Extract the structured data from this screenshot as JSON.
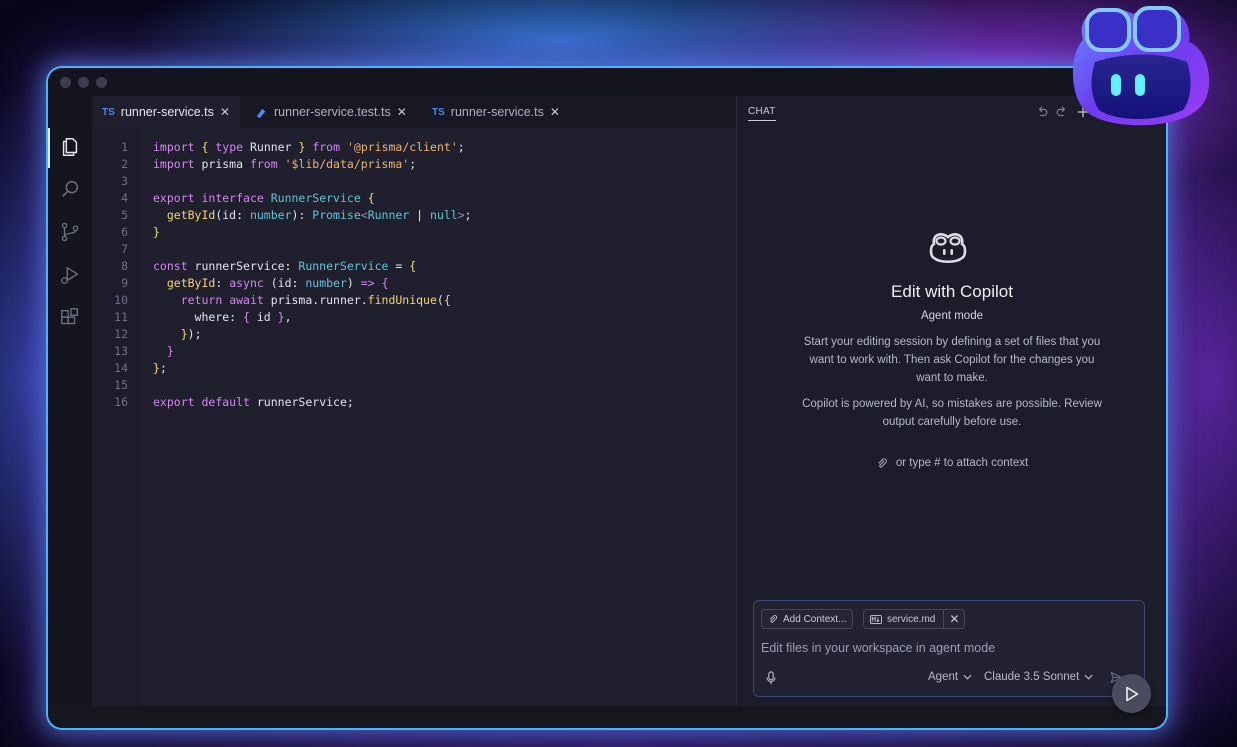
{
  "tabs": [
    {
      "badge": "TS",
      "label": "runner-service.ts",
      "close": "✕",
      "active": true
    },
    {
      "badge": "",
      "label": "runner-service.test.ts",
      "close": "✕",
      "active": false
    },
    {
      "badge": "TS",
      "label": "runner-service.ts",
      "close": "✕",
      "active": false
    }
  ],
  "code_lines": [
    [
      {
        "t": "import",
        "c": "kw"
      },
      {
        "t": " "
      },
      {
        "t": "{",
        "c": "br"
      },
      {
        "t": " "
      },
      {
        "t": "type",
        "c": "kw"
      },
      {
        "t": " Runner "
      },
      {
        "t": "}",
        "c": "br"
      },
      {
        "t": " "
      },
      {
        "t": "from",
        "c": "kw"
      },
      {
        "t": " "
      },
      {
        "t": "'@prisma/client'",
        "c": "st"
      },
      {
        "t": ";"
      }
    ],
    [
      {
        "t": "import",
        "c": "kw"
      },
      {
        "t": " prisma "
      },
      {
        "t": "from",
        "c": "kw"
      },
      {
        "t": " "
      },
      {
        "t": "'$lib/data/prisma'",
        "c": "st"
      },
      {
        "t": ";"
      }
    ],
    [],
    [
      {
        "t": "export",
        "c": "kw"
      },
      {
        "t": " "
      },
      {
        "t": "interface",
        "c": "kw"
      },
      {
        "t": " "
      },
      {
        "t": "RunnerService",
        "c": "ty"
      },
      {
        "t": " "
      },
      {
        "t": "{",
        "c": "br"
      }
    ],
    [
      {
        "t": "  "
      },
      {
        "t": "getById",
        "c": "fn"
      },
      {
        "t": "(id: "
      },
      {
        "t": "number",
        "c": "ty"
      },
      {
        "t": "): "
      },
      {
        "t": "Promise",
        "c": "ty"
      },
      {
        "t": "<",
        "c": "op"
      },
      {
        "t": "Runner",
        "c": "ty"
      },
      {
        "t": " | "
      },
      {
        "t": "null",
        "c": "ty"
      },
      {
        "t": ">",
        "c": "op"
      },
      {
        "t": ";"
      }
    ],
    [
      {
        "t": "}",
        "c": "br"
      }
    ],
    [],
    [
      {
        "t": "const",
        "c": "kw"
      },
      {
        "t": " runnerService: "
      },
      {
        "t": "RunnerService",
        "c": "ty"
      },
      {
        "t": " = "
      },
      {
        "t": "{",
        "c": "br"
      }
    ],
    [
      {
        "t": "  "
      },
      {
        "t": "getById",
        "c": "fn"
      },
      {
        "t": ": "
      },
      {
        "t": "async",
        "c": "kw"
      },
      {
        "t": " (id: "
      },
      {
        "t": "number",
        "c": "ty"
      },
      {
        "t": ") "
      },
      {
        "t": "=>",
        "c": "kw"
      },
      {
        "t": " "
      },
      {
        "t": "{",
        "c": "kw"
      }
    ],
    [
      {
        "t": "    "
      },
      {
        "t": "return",
        "c": "kw"
      },
      {
        "t": " "
      },
      {
        "t": "await",
        "c": "kw"
      },
      {
        "t": " prisma.runner."
      },
      {
        "t": "findUnique",
        "c": "fn"
      },
      {
        "t": "("
      },
      {
        "t": "{",
        "c": "br"
      }
    ],
    [
      {
        "t": "      where: "
      },
      {
        "t": "{",
        "c": "kw"
      },
      {
        "t": " id "
      },
      {
        "t": "}",
        "c": "kw"
      },
      {
        "t": ","
      }
    ],
    [
      {
        "t": "    "
      },
      {
        "t": "}",
        "c": "br"
      },
      {
        "t": ");"
      }
    ],
    [
      {
        "t": "  "
      },
      {
        "t": "}",
        "c": "kw"
      }
    ],
    [
      {
        "t": "}",
        "c": "br"
      },
      {
        "t": ";"
      }
    ],
    [],
    [
      {
        "t": "export",
        "c": "kw"
      },
      {
        "t": " "
      },
      {
        "t": "default",
        "c": "kw"
      },
      {
        "t": " runnerService;"
      }
    ]
  ],
  "chat": {
    "label": "CHAT",
    "title": "Edit with Copilot",
    "mode": "Agent mode",
    "para1": "Start your editing session by defining a set of files that you want to work with. Then ask Copilot for the changes you want to make.",
    "para2": "Copilot is powered by AI, so mistakes are possible. Review output carefully before use.",
    "attach_hint": "or type # to attach context",
    "add_context": "Add Context...",
    "file_chip": "service.md",
    "placeholder": "Edit files in your workspace in agent mode",
    "agent_select": "Agent",
    "model_select": "Claude 3.5 Sonnet"
  },
  "colors": {
    "accent": "#3f8cf5",
    "keyword": "#d686f0",
    "type": "#5ec5d8",
    "function": "#f0d66e",
    "string": "#eeb274",
    "border_glow": "#4ab3ff"
  }
}
